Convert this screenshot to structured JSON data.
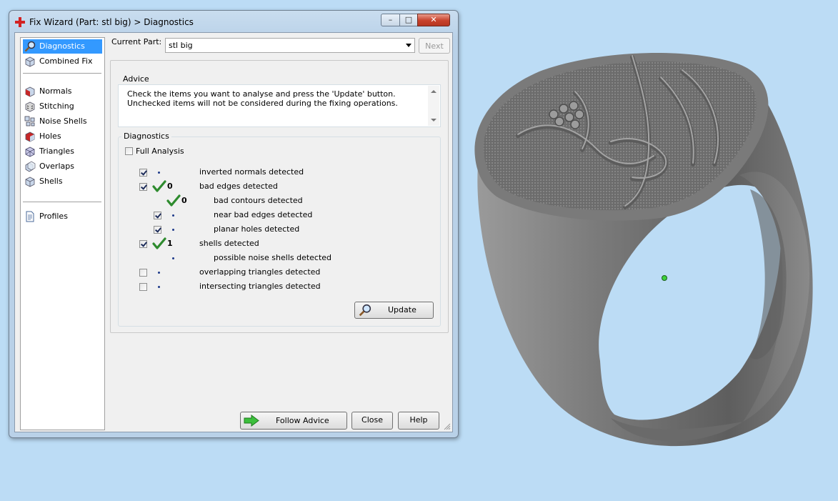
{
  "window": {
    "title": "Fix Wizard (Part: stl big) > Diagnostics",
    "icon": "red-cross-icon",
    "caption_buttons": {
      "minimize": "–",
      "maximize": "□",
      "close": "✕"
    }
  },
  "sidebar": {
    "items": [
      {
        "label": "Diagnostics",
        "icon": "magnifier-icon",
        "selected": true
      },
      {
        "label": "Combined Fix",
        "icon": "cube-icon"
      },
      {
        "label": "Normals",
        "icon": "cube-red-face-icon"
      },
      {
        "label": "Stitching",
        "icon": "cube-stitching-icon"
      },
      {
        "label": "Noise Shells",
        "icon": "noise-shells-icon"
      },
      {
        "label": "Holes",
        "icon": "cube-holes-icon"
      },
      {
        "label": "Triangles",
        "icon": "triangles-icon"
      },
      {
        "label": "Overlaps",
        "icon": "overlaps-icon"
      },
      {
        "label": "Shells",
        "icon": "shells-icon"
      },
      {
        "label": "Profiles",
        "icon": "document-icon"
      }
    ]
  },
  "header": {
    "current_part_label": "Current Part:",
    "current_part_value": "stl big",
    "next_label": "Next"
  },
  "advice": {
    "title": "Advice",
    "text": "Check the items you want to analyse and press the 'Update' button. Unchecked items will not be considered during the fixing operations."
  },
  "diagnostics": {
    "title": "Diagnostics",
    "full_analysis_label": "Full Analysis",
    "full_analysis_checked": false,
    "rows": [
      {
        "checked": true,
        "count": "",
        "label": "inverted normals detected"
      },
      {
        "checked": true,
        "count": "0",
        "label": "bad edges detected",
        "ok": true
      },
      {
        "checked": null,
        "count": "0",
        "label": "bad contours detected",
        "ok": true
      },
      {
        "checked": true,
        "count": "",
        "label": "near bad edges detected"
      },
      {
        "checked": true,
        "count": "",
        "label": "planar holes detected"
      },
      {
        "checked": true,
        "count": "1",
        "label": "shells detected",
        "ok": true
      },
      {
        "checked": null,
        "count": "",
        "label": "possible noise shells detected"
      },
      {
        "checked": false,
        "count": "",
        "label": "overlapping triangles detected"
      },
      {
        "checked": false,
        "count": "",
        "label": "intersecting triangles detected"
      }
    ],
    "update_label": "Update"
  },
  "footer": {
    "follow_advice_label": "Follow Advice",
    "close_label": "Close",
    "help_label": "Help"
  },
  "colors": {
    "desktop_bg": "#bcdcf5",
    "selection": "#3399ff",
    "check_green": "#2e8b2e",
    "ring_gray": "#6e6e6e"
  }
}
